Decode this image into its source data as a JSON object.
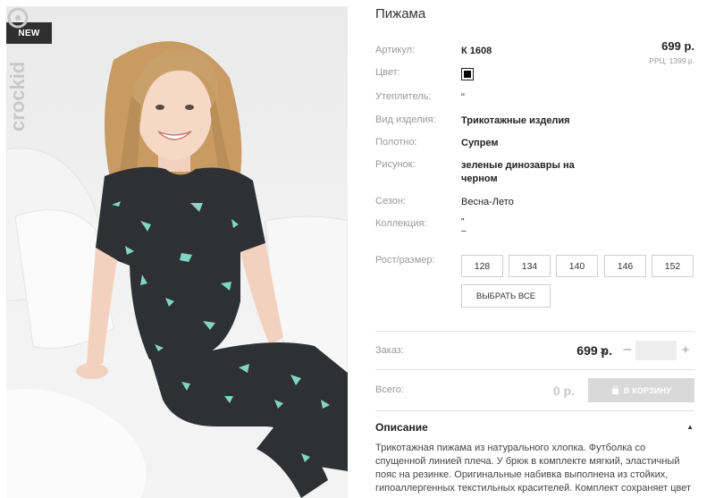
{
  "product": {
    "badge": "NEW",
    "brand": "crockid",
    "title": "Пижама",
    "price": "699 р.",
    "rrp": "РРЦ: 1399 р."
  },
  "properties": [
    {
      "label": "Артикул:",
      "value": "К 1608",
      "bold": true
    },
    {
      "label": "Цвет:",
      "value": "",
      "swatch_color": "#000000"
    },
    {
      "label": "Утеплитель:",
      "value": "\"",
      "bold": false
    },
    {
      "label": "Вид изделия:",
      "value": "Трикотажные изделия",
      "bold": true
    },
    {
      "label": "Полотно:",
      "value": "Супрем",
      "bold": true
    },
    {
      "label": "Рисунок:",
      "value": "зеленые динозавры на черном",
      "bold": true
    },
    {
      "label": "Сезон:",
      "value": "Весна-Лето",
      "bold": false
    },
    {
      "label": "Коллекция:",
      "value": "\"\n–",
      "bold": false
    }
  ],
  "sizes": {
    "label": "Рост/размер:",
    "options": [
      "128",
      "134",
      "140",
      "146",
      "152"
    ],
    "select_all_label": "ВЫБРАТЬ ВСЕ"
  },
  "order": {
    "label": "Заказ:",
    "price": "699 р.",
    "times_symbol": "×",
    "minus": "–",
    "plus": "+",
    "quantity": ""
  },
  "total": {
    "label": "Всего:",
    "value": "0 р.",
    "cart_button_label": "В КОРЗИНУ"
  },
  "description": {
    "heading": "Описание",
    "text": "Трикотажная пижама из натурального хлопка. Футболка со спущенной линией плеча. У брюк в комплекте мягкий, эластичный пояс на резинке. Оригинальные набивка выполнена из стойких, гипоаллергенных текстильных красителей. Комплект сохраняет цвет"
  },
  "colors": {
    "badge_bg": "#2f2f2f",
    "garment": "#2e3033",
    "print": "#7fd6c2",
    "cart_button_bg": "#d9d9d9"
  }
}
